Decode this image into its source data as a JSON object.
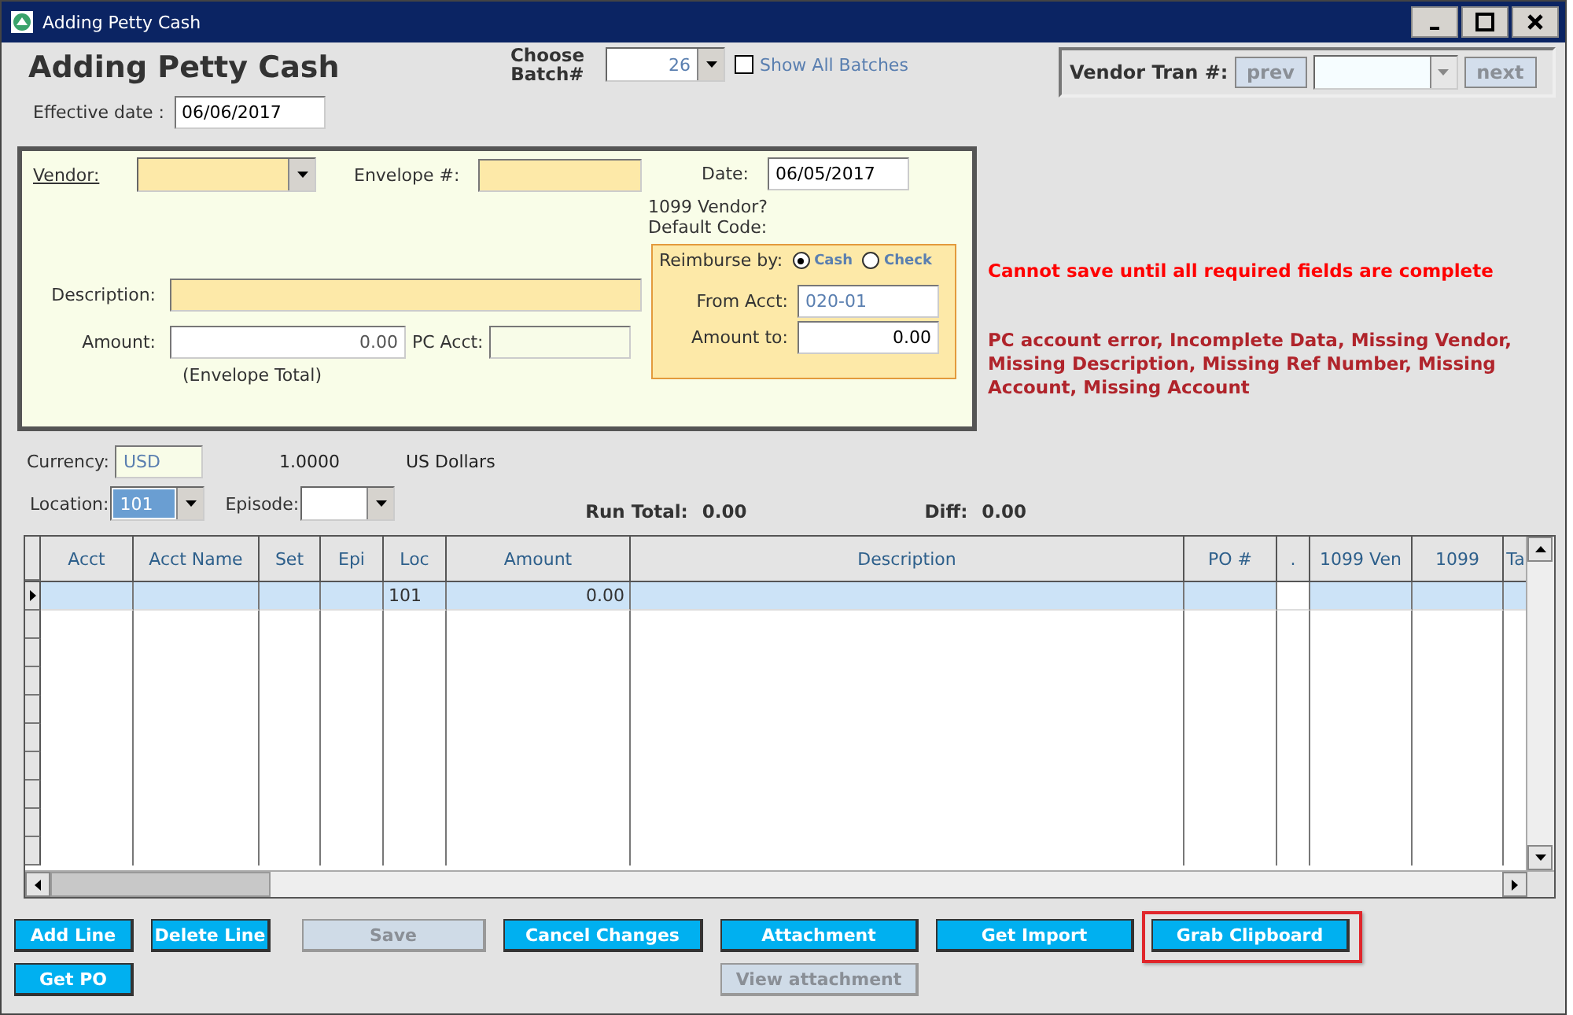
{
  "window": {
    "title": "Adding Petty Cash"
  },
  "heading": "Adding Petty Cash",
  "batch": {
    "label": "Choose Batch#",
    "value": "26",
    "show_all": {
      "label": "Show All Batches",
      "checked": false
    }
  },
  "effective_date": {
    "label": "Effective date :",
    "value": "06/06/2017"
  },
  "vendor_tran": {
    "label": "Vendor Tran #:",
    "prev": {
      "label": "prev",
      "disabled": true
    },
    "next": {
      "label": "next",
      "disabled": true
    }
  },
  "envelope": {
    "vendor_label": "Vendor:",
    "envelope_label": "Envelope #:",
    "date_label": "Date:",
    "date": "06/05/2017",
    "vendor_1099": "1099 Vendor?",
    "default_code": "Default Code:",
    "description_label": "Description:",
    "amount_label": "Amount:",
    "amount": "0.00",
    "pc_acct_label": "PC Acct:",
    "envelope_total": "(Envelope Total)",
    "reimburse": {
      "label": "Reimburse by:",
      "options": [
        {
          "label": "Cash",
          "selected": true
        },
        {
          "label": "Check",
          "selected": false
        }
      ],
      "from_acct_label": "From Acct:",
      "from_acct": "020-01",
      "amount_to_label": "Amount to:",
      "amount_to": "0.00"
    }
  },
  "messages": {
    "warning": "Cannot save until all required fields are complete",
    "errors": "PC account error, Incomplete Data, Missing Vendor, Missing Description, Missing Ref Number, Missing Account, Missing Account"
  },
  "currency": {
    "label": "Currency:",
    "code": "USD",
    "rate": "1.0000",
    "name": "US Dollars"
  },
  "location": {
    "label": "Location:",
    "value": "101"
  },
  "episode": {
    "label": "Episode:"
  },
  "run_total": {
    "label": "Run Total:",
    "value": "0.00"
  },
  "diff": {
    "label": "Diff:",
    "value": "0.00"
  },
  "table": {
    "columns": [
      "Acct",
      "Acct Name",
      "Set",
      "Epi",
      "Loc",
      "Amount",
      "Description",
      "PO #",
      ".",
      "1099 Ven",
      "1099",
      "Ta"
    ],
    "rows": [
      {
        "selected": true,
        "cells": [
          "",
          "",
          "",
          "",
          "101",
          "0.00",
          "",
          "",
          "",
          "",
          "",
          ""
        ]
      }
    ]
  },
  "button_rows": [
    [
      {
        "label": "Add Line",
        "disabled": false,
        "highlighted": false
      },
      {
        "label": "Delete Line",
        "disabled": false,
        "highlighted": false
      },
      {
        "label": "Save",
        "disabled": true,
        "highlighted": false
      },
      {
        "label": "Cancel Changes",
        "disabled": false,
        "highlighted": false
      },
      {
        "label": "Attachment",
        "disabled": false,
        "highlighted": false
      },
      {
        "label": "Get Import",
        "disabled": false,
        "highlighted": false
      },
      {
        "label": "Grab Clipboard",
        "disabled": false,
        "highlighted": true
      }
    ],
    [
      {
        "label": "Get PO",
        "disabled": false,
        "highlighted": false
      },
      {
        "label": "View attachment",
        "disabled": true,
        "highlighted": false
      }
    ]
  ]
}
